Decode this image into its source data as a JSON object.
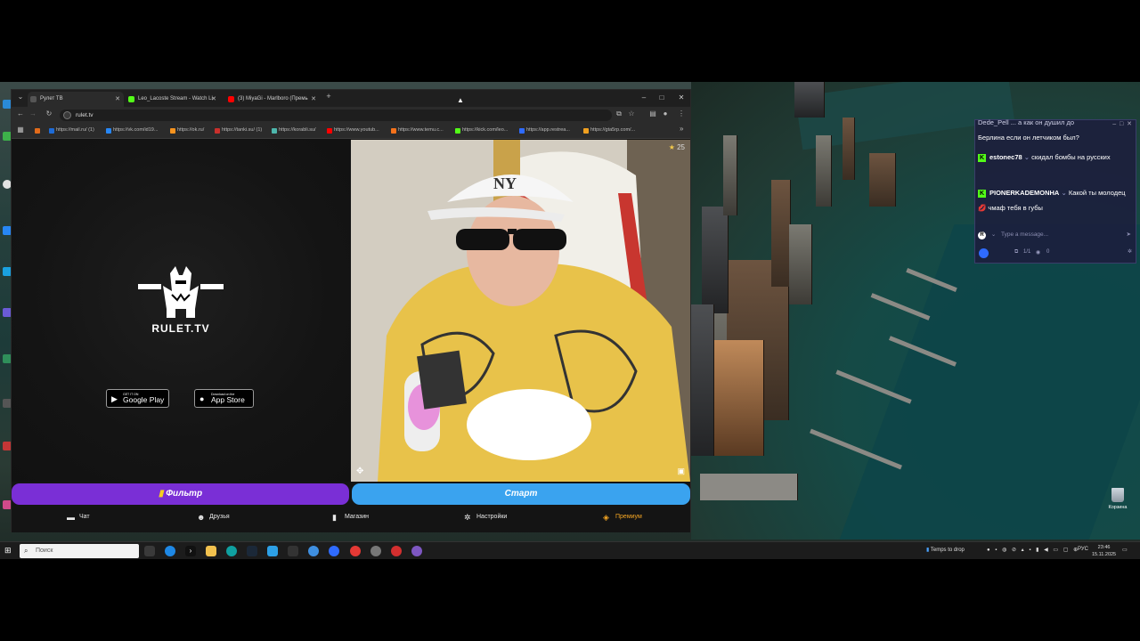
{
  "browser": {
    "tabs": [
      {
        "title": "Рулет ТВ",
        "favicon_color": "#3a3a3a",
        "active": true
      },
      {
        "title": "Leo_Lacoste Stream - Watch Li",
        "favicon_color": "#53fc18",
        "active": false
      },
      {
        "title": "(3) MiyaGi - Marlboro (Премь",
        "favicon_color": "#ff0000",
        "active": false
      }
    ],
    "new_tab": "+",
    "controls": {
      "minimize": "–",
      "maximize": "□",
      "close": "✕"
    },
    "address": "rulet.tv",
    "bookmarks": [
      {
        "label": "https://mail.ru/ (1)",
        "color": "#1e6bd6"
      },
      {
        "label": "https://vk.com/id19...",
        "color": "#2787f5"
      },
      {
        "label": "https://ok.ru/",
        "color": "#f7931e"
      },
      {
        "label": "https://tanki.su/ (1)",
        "color": "#c9302c"
      },
      {
        "label": "https://korabli.su/",
        "color": "#4db6ac"
      },
      {
        "label": "https://www.youtub...",
        "color": "#ff0000"
      },
      {
        "label": "https://www.temu.c...",
        "color": "#f5721b"
      },
      {
        "label": "https://kick.com/leo...",
        "color": "#53fc18"
      },
      {
        "label": "https://app.restrea...",
        "color": "#2f6bff"
      },
      {
        "label": "https://gta5rp.com/...",
        "color": "#f0a020"
      }
    ]
  },
  "site": {
    "brand": "RULET.TV",
    "google_play": {
      "small": "GET IT ON",
      "big": "Google Play"
    },
    "app_store": {
      "small": "Download on the",
      "big": "App Store"
    },
    "likes": "25",
    "filter_button": "Фильтр",
    "start_button": "Старт",
    "nav": [
      {
        "label": "Чат",
        "icon": "chat-icon"
      },
      {
        "label": "Друзья",
        "icon": "friends-icon"
      },
      {
        "label": "Магазин",
        "icon": "shop-icon"
      },
      {
        "label": "Настройки",
        "icon": "gear-icon"
      },
      {
        "label": "Премиум",
        "icon": "premium-icon"
      }
    ],
    "colors": {
      "filter": "#7a2fd6",
      "start": "#3aa3ef",
      "premium": "#f5a623"
    }
  },
  "chat": {
    "messages": [
      {
        "user": "",
        "text": "Берлина если он летчиком был?"
      },
      {
        "user": "estonec78",
        "text": "скидал бомбы на русских"
      },
      {
        "user": "PIONERKADEMONHA",
        "text": "Какой ты молодец 💋 чмаф тебя в губы"
      }
    ],
    "partial_header": "Dede_Pell ... а как он душил до",
    "input_placeholder": "Type a message...",
    "footer": {
      "viewers_ratio": "1/1",
      "views": "0"
    }
  },
  "desktop": {
    "trash_label": "Корзина"
  },
  "taskbar": {
    "search_placeholder": "Поиск",
    "weather": "Temps to drop",
    "lang": "РУС",
    "time": "23:46",
    "date": "15.11.2025"
  }
}
